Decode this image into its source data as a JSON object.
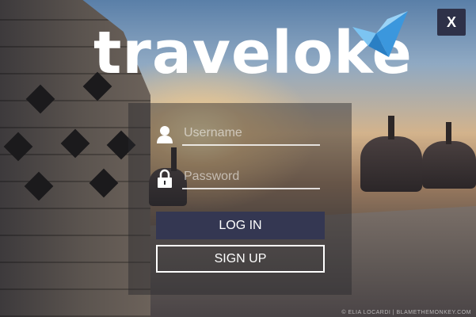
{
  "brand": {
    "logo_text": "traveloke",
    "logo_color": "#ffffff",
    "bird_color": "#4ba3e3"
  },
  "window": {
    "close_label": "X"
  },
  "login_form": {
    "username_placeholder": "Username",
    "username_value": "",
    "password_placeholder": "Password",
    "password_value": "",
    "login_label": "LOG IN",
    "signup_label": "SIGN UP"
  },
  "photo_credit": "© ELIA LOCARDI | BLAMETHEMONKEY.COM",
  "icons": {
    "username": "user-icon",
    "password": "lock-icon"
  },
  "colors": {
    "button_dark": "#343752",
    "close_bg": "#2e3148"
  }
}
